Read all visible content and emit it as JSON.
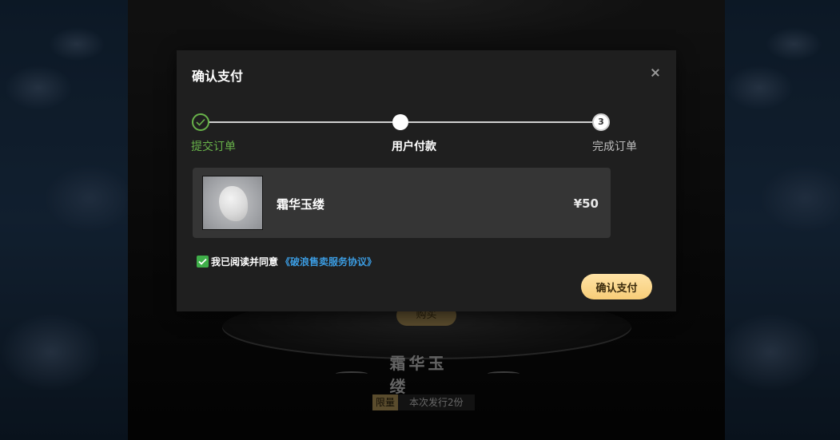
{
  "background": {
    "buy_button_label": "购买",
    "item_title": "霜华玉缕",
    "limit_badge": "限量",
    "limit_text": "本次发行2份"
  },
  "modal": {
    "title": "确认支付",
    "close_icon": "close-icon",
    "steps": [
      {
        "label": "提交订单",
        "state": "done"
      },
      {
        "label": "用户付款",
        "state": "current"
      },
      {
        "label": "完成订单",
        "state": "todo",
        "number": "3"
      }
    ],
    "product": {
      "name": "霜华玉缕",
      "price": "¥50"
    },
    "agreement": {
      "checked": true,
      "text": "我已阅读并同意",
      "link": "《破浪售卖服务协议》"
    },
    "confirm_label": "确认支付"
  },
  "colors": {
    "success": "#68b24a",
    "link": "#3b9be0",
    "checkbox": "#3fae49",
    "button_gold": "#f7cd78"
  }
}
